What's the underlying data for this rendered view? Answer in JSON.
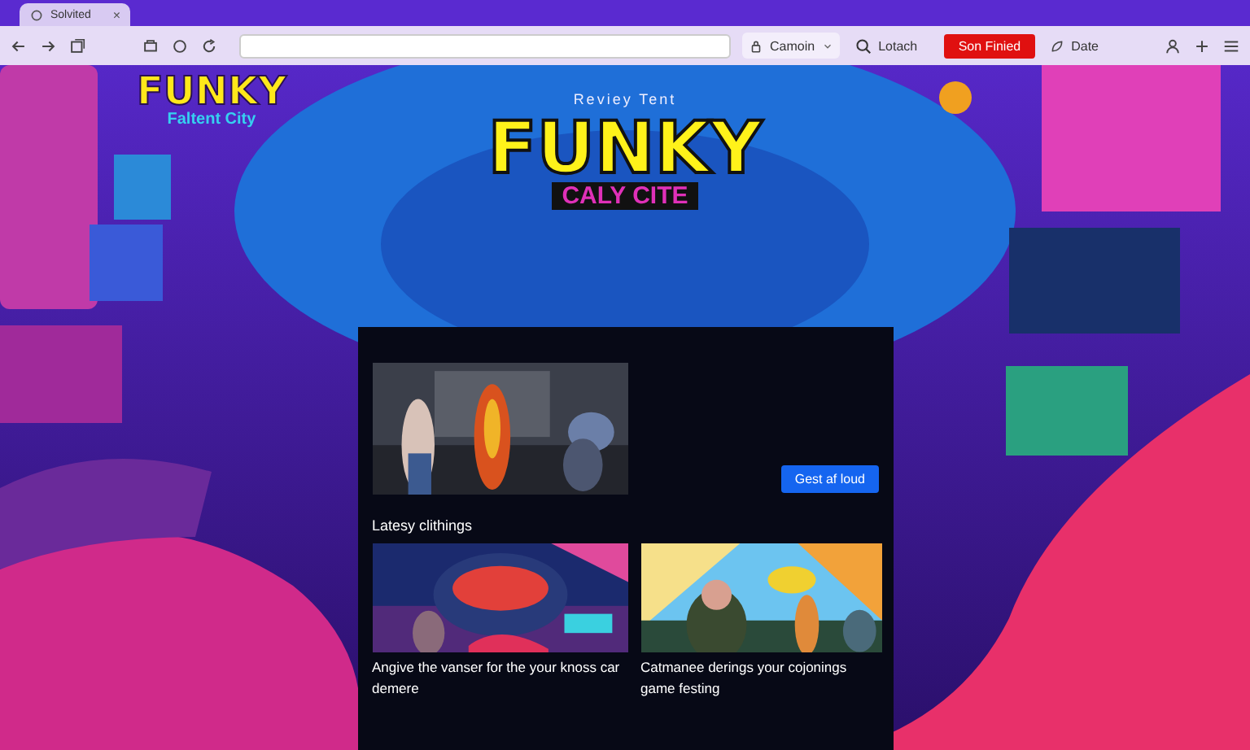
{
  "browser": {
    "tab": {
      "title": "Solvited",
      "close": "×"
    },
    "toolbar": {
      "profile": {
        "label": "Camoin"
      },
      "search": {
        "label": "Lotach"
      },
      "sign_in_button": "Son Finied",
      "date_button": "Date"
    }
  },
  "page": {
    "logo": {
      "title": "FUNKY",
      "subtitle": "Faltent City"
    },
    "hero": {
      "kicker": "Reviey Tent",
      "title": "FUNKY",
      "subtitle": "CALY CITE"
    },
    "feature": {
      "button": "Gest af loud"
    },
    "section_title": "Latesy clithings",
    "cards": [
      {
        "caption": "Angive the vanser for the your knoss car demere"
      },
      {
        "caption": "Catmanee derings your cojonings game festing"
      }
    ]
  }
}
